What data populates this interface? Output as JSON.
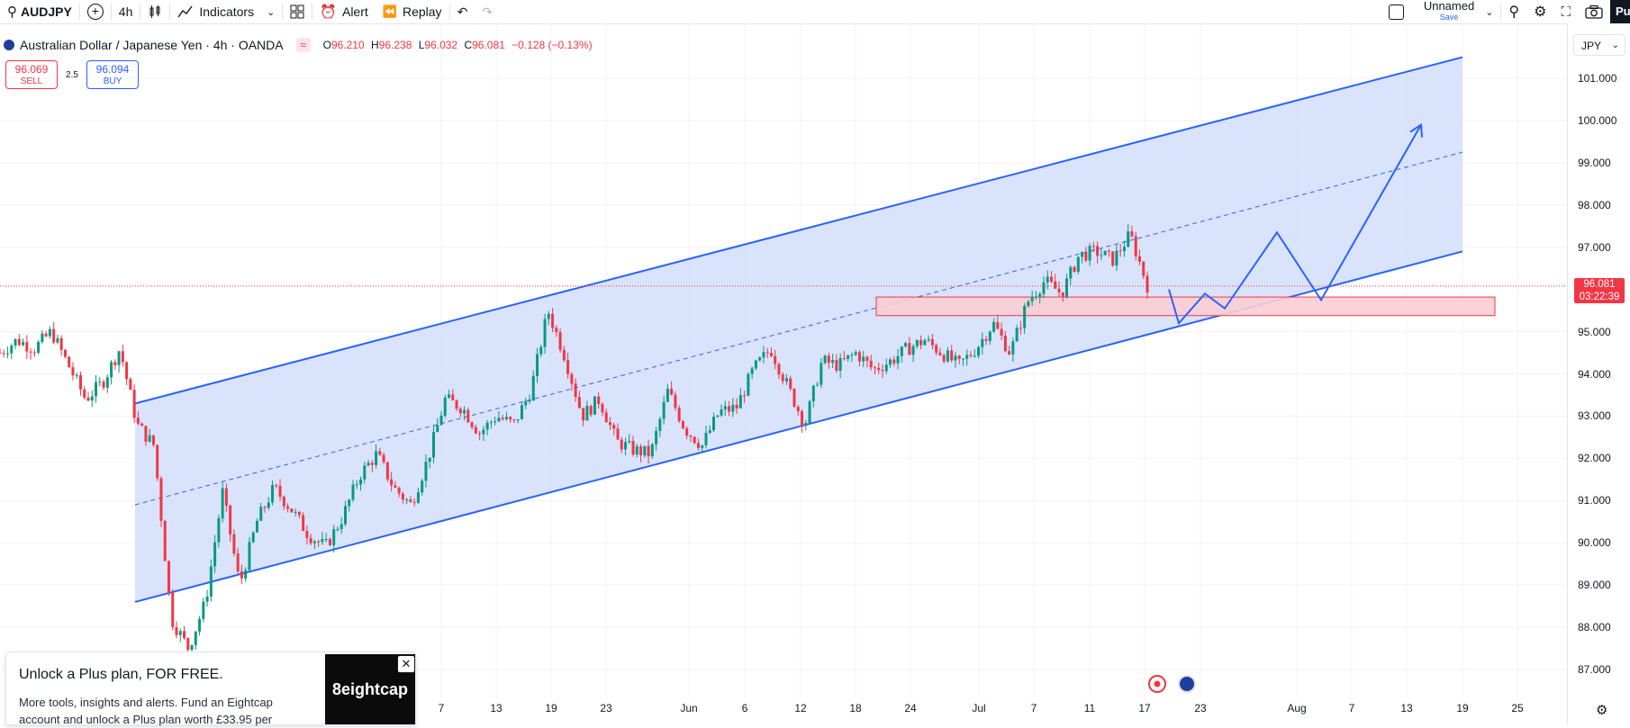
{
  "toolbar": {
    "symbol": "AUDJPY",
    "interval": "4h",
    "indicators_label": "Indicators",
    "alert_label": "Alert",
    "replay_label": "Replay",
    "layout_name": "Unnamed",
    "save_label": "Save",
    "publish_partial": "Pu"
  },
  "legend": {
    "title": "Australian Dollar / Japanese Yen · 4h · OANDA",
    "o_key": "O",
    "o_val": "96.210",
    "h_key": "H",
    "h_val": "96.238",
    "l_key": "L",
    "l_val": "96.032",
    "c_key": "C",
    "c_val": "96.081",
    "change": "−0.128 (−0.13%)"
  },
  "trade": {
    "sell_price": "96.069",
    "sell_label": "SELL",
    "spread": "2.5",
    "buy_price": "96.094",
    "buy_label": "BUY"
  },
  "price_axis": {
    "currency": "JPY",
    "labels": [
      "101.000",
      "100.000",
      "99.000",
      "98.000",
      "97.000",
      "95.000",
      "94.000",
      "93.000",
      "92.000",
      "91.000",
      "90.000",
      "89.000",
      "88.000",
      "87.000"
    ],
    "current_price": "96.081",
    "countdown": "03:22:39"
  },
  "time_axis": {
    "labels": [
      "7",
      "13",
      "19",
      "23",
      "Jun",
      "6",
      "12",
      "18",
      "24",
      "Jul",
      "7",
      "11",
      "17",
      "23",
      "Aug",
      "7",
      "13",
      "19",
      "25"
    ]
  },
  "promo": {
    "title": "Unlock a Plus plan, FOR FREE.",
    "text": "More tools, insights and alerts. Fund an Eightcap account and unlock a Plus plan worth £33.95 per",
    "brand": "8eightcap"
  },
  "colors": {
    "up": "#089981",
    "down": "#f23645",
    "channel": "#2962ff",
    "channel_fill": "#d2defb",
    "zone_fill": "#f9cdd3"
  },
  "chart_data": {
    "type": "candlestick",
    "symbol": "AUDJPY",
    "timeframe": "4h",
    "ylim": [
      86.7,
      101.5
    ],
    "last_close": 96.081,
    "channel": {
      "upper": {
        "start": 93.3,
        "end": 101.5
      },
      "mid": {
        "start": 90.9,
        "end": 99.25
      },
      "lower": {
        "start": 88.6,
        "end": 96.9
      }
    },
    "support_zone": [
      95.38,
      95.82
    ],
    "projection_path": [
      96.0,
      95.2,
      95.9,
      95.55,
      97.35,
      95.75,
      99.9
    ],
    "price_path": [
      94.5,
      94.8,
      94.6,
      95.0,
      94.2,
      93.4,
      93.8,
      94.6,
      92.8,
      92.3,
      88.2,
      87.5,
      88.6,
      91.2,
      89.0,
      90.5,
      91.3,
      90.8,
      90.2,
      89.9,
      90.6,
      91.6,
      92.1,
      91.3,
      90.9,
      92.0,
      93.4,
      93.2,
      92.6,
      93.0,
      92.8,
      93.6,
      95.5,
      94.4,
      93.0,
      93.4,
      92.4,
      92.2,
      92.1,
      93.6,
      92.7,
      92.3,
      93.1,
      93.2,
      94.1,
      94.6,
      93.7,
      92.8,
      94.3,
      94.2,
      94.5,
      94.1,
      94.3,
      94.6,
      94.8,
      94.5,
      94.2,
      94.6,
      95.2,
      94.5,
      95.7,
      96.2,
      95.9,
      96.8,
      96.9,
      96.7,
      97.3,
      96.1
    ]
  }
}
